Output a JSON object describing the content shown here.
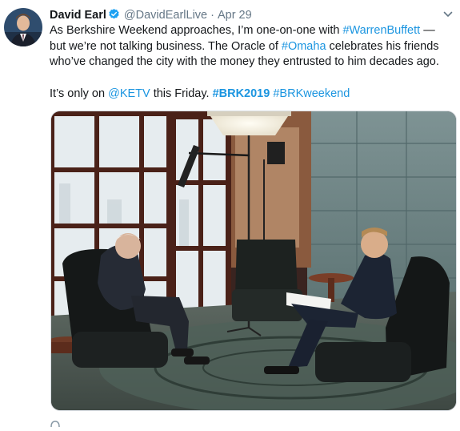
{
  "tweet": {
    "author_name": "David Earl",
    "handle": "@DavidEarlLive",
    "separator": "·",
    "date": "Apr 29",
    "text_1_pre": "As Berkshire Weekend approaches, I’m one-on-one with ",
    "mention_buffett": "#WarrenBuffett",
    "text_1_mid": " — but we’re not talking business. The Oracle of ",
    "hashtag_omaha": "#Omaha",
    "text_1_post": " celebrates his friends who’ve changed the city with the money they entrusted to him decades ago.",
    "text_2_pre": "It’s only on ",
    "mention_ketv": "@KETV",
    "text_2_mid": " this Friday. ",
    "hashtag_brk2019": "#BRK2019",
    "text_2_space": " ",
    "hashtag_brkweekend": "#BRKweekend"
  },
  "icons": {
    "verified": "verified-badge-icon",
    "caret": "chevron-down-icon",
    "reply": "reply-icon"
  },
  "colors": {
    "link": "#1b95e0",
    "text": "#14171a",
    "secondary": "#657786"
  }
}
